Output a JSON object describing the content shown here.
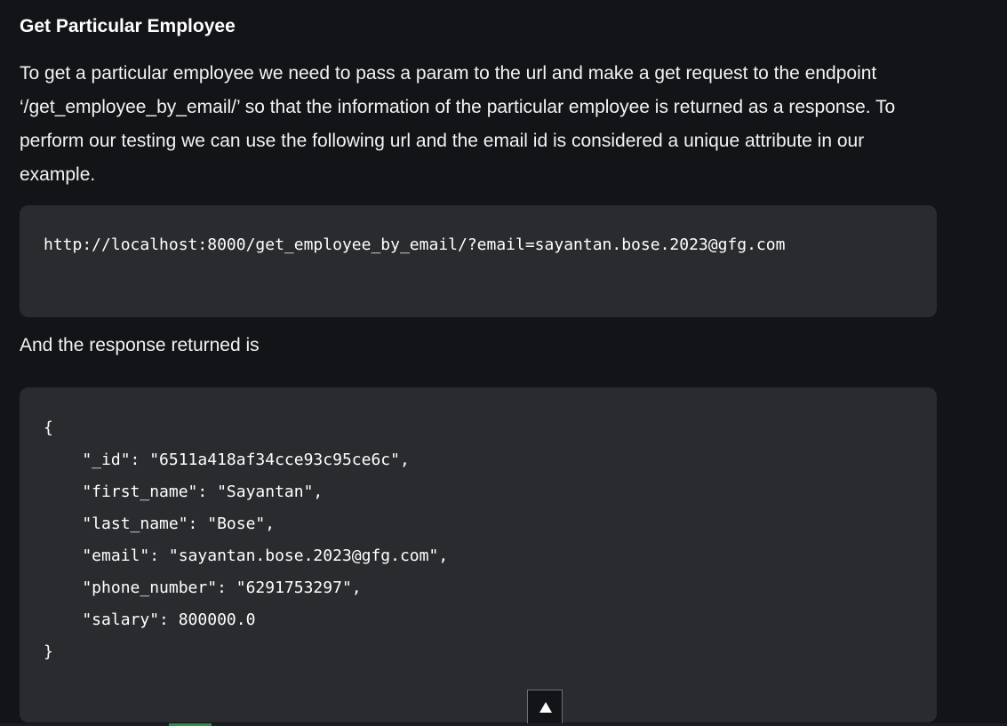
{
  "article": {
    "heading": "Get Particular Employee",
    "paragraph": "To get a particular employee we need to pass a param to the url and make a get request to the endpoint ‘/get_employee_by_email/’ so that the information of the particular employee is returned as a response. To perform our testing we can use the following url and the email id is considered a unique attribute in our example.",
    "url_code": "http://localhost:8000/get_employee_by_email/?email=sayantan.bose.2023@gfg.com",
    "response_intro": "And the response returned is",
    "response_lines": [
      "{",
      "    \"_id\": \"6511a418af34cce93c95ce6c\",",
      "    \"first_name\": \"Sayantan\",",
      "    \"last_name\": \"Bose\",",
      "    \"email\": \"sayantan.bose.2023@gfg.com\",",
      "    \"phone_number\": \"6291753297\",",
      "    \"salary\": 800000.0",
      "}"
    ]
  },
  "ui": {
    "scroll_top_icon": "up-triangle-icon",
    "accent_color": "#2f8d46",
    "background_color": "#131417",
    "code_background_color": "#2a2b2e"
  }
}
